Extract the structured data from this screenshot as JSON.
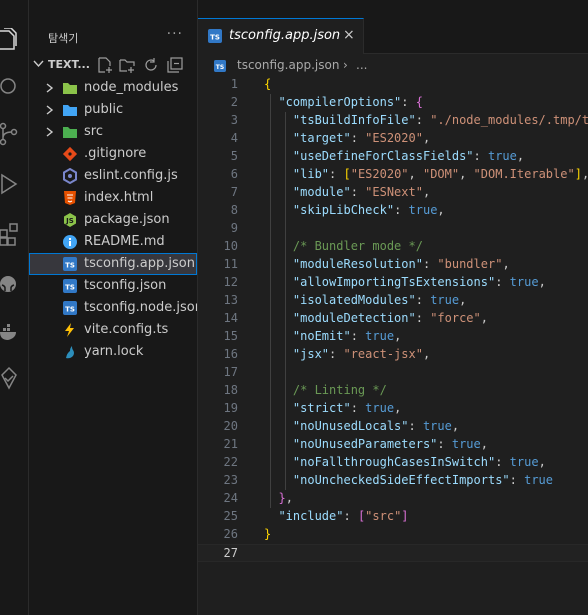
{
  "explorer": {
    "title": "탐색기",
    "more": "···",
    "folder_name": "TEXT...",
    "items": [
      {
        "label": "node_modules",
        "icon": "folder-node-icon",
        "kind": "folder",
        "color": "#8bc34a",
        "selected": false
      },
      {
        "label": "public",
        "icon": "folder-public-icon",
        "kind": "folder",
        "color": "#42a5f5",
        "selected": false
      },
      {
        "label": "src",
        "icon": "folder-src-icon",
        "kind": "folder",
        "color": "#4caf50",
        "selected": false
      },
      {
        "label": ".gitignore",
        "icon": "git-icon",
        "kind": "file",
        "color": "#e64a19",
        "selected": false
      },
      {
        "label": "eslint.config.js",
        "icon": "eslint-icon",
        "kind": "file",
        "color": "#7986cb",
        "selected": false
      },
      {
        "label": "index.html",
        "icon": "html-icon",
        "kind": "file",
        "color": "#e65100",
        "selected": false
      },
      {
        "label": "package.json",
        "icon": "nodejs-icon",
        "kind": "file",
        "color": "#8bc34a",
        "selected": false
      },
      {
        "label": "README.md",
        "icon": "info-icon",
        "kind": "file",
        "color": "#42a5f5",
        "selected": false
      },
      {
        "label": "tsconfig.app.json",
        "icon": "tsconfig-icon",
        "kind": "file",
        "color": "#3178c6",
        "selected": true
      },
      {
        "label": "tsconfig.json",
        "icon": "tsconfig-icon",
        "kind": "file",
        "color": "#3178c6",
        "selected": false
      },
      {
        "label": "tsconfig.node.json",
        "icon": "tsconfig-icon",
        "kind": "file",
        "color": "#3178c6",
        "selected": false
      },
      {
        "label": "vite.config.ts",
        "icon": "vite-icon",
        "kind": "file",
        "color": "#ffc107",
        "selected": false
      },
      {
        "label": "yarn.lock",
        "icon": "yarn-icon",
        "kind": "file",
        "color": "#2c8ebb",
        "selected": false
      }
    ]
  },
  "editor": {
    "tab_label": "tsconfig.app.json",
    "tab_close": "×",
    "breadcrumb_file": "tsconfig.app.json",
    "breadcrumb_sep": "›",
    "breadcrumb_more": "...",
    "current_line": 27,
    "lines": [
      [
        [
          "brace",
          "{"
        ]
      ],
      [
        [
          "p",
          "  "
        ],
        [
          "key",
          "\"compilerOptions\""
        ],
        [
          "p",
          ": "
        ],
        [
          "bracket",
          "{"
        ]
      ],
      [
        [
          "p",
          "    "
        ],
        [
          "key",
          "\"tsBuildInfoFile\""
        ],
        [
          "p",
          ": "
        ],
        [
          "str",
          "\"./node_modules/.tmp/t"
        ]
      ],
      [
        [
          "p",
          "    "
        ],
        [
          "key",
          "\"target\""
        ],
        [
          "p",
          ": "
        ],
        [
          "str",
          "\"ES2020\""
        ],
        [
          "p",
          ","
        ]
      ],
      [
        [
          "p",
          "    "
        ],
        [
          "key",
          "\"useDefineForClassFields\""
        ],
        [
          "p",
          ": "
        ],
        [
          "bool",
          "true"
        ],
        [
          "p",
          ","
        ]
      ],
      [
        [
          "p",
          "    "
        ],
        [
          "key",
          "\"lib\""
        ],
        [
          "p",
          ": "
        ],
        [
          "brace",
          "["
        ],
        [
          "str",
          "\"ES2020\""
        ],
        [
          "p",
          ", "
        ],
        [
          "str",
          "\"DOM\""
        ],
        [
          "p",
          ", "
        ],
        [
          "str",
          "\"DOM.Iterable\""
        ],
        [
          "brace",
          "]"
        ],
        [
          "p",
          ","
        ]
      ],
      [
        [
          "p",
          "    "
        ],
        [
          "key",
          "\"module\""
        ],
        [
          "p",
          ": "
        ],
        [
          "str",
          "\"ESNext\""
        ],
        [
          "p",
          ","
        ]
      ],
      [
        [
          "p",
          "    "
        ],
        [
          "key",
          "\"skipLibCheck\""
        ],
        [
          "p",
          ": "
        ],
        [
          "bool",
          "true"
        ],
        [
          "p",
          ","
        ]
      ],
      [],
      [
        [
          "p",
          "    "
        ],
        [
          "com",
          "/* Bundler mode */"
        ]
      ],
      [
        [
          "p",
          "    "
        ],
        [
          "key",
          "\"moduleResolution\""
        ],
        [
          "p",
          ": "
        ],
        [
          "str",
          "\"bundler\""
        ],
        [
          "p",
          ","
        ]
      ],
      [
        [
          "p",
          "    "
        ],
        [
          "key",
          "\"allowImportingTsExtensions\""
        ],
        [
          "p",
          ": "
        ],
        [
          "bool",
          "true"
        ],
        [
          "p",
          ","
        ]
      ],
      [
        [
          "p",
          "    "
        ],
        [
          "key",
          "\"isolatedModules\""
        ],
        [
          "p",
          ": "
        ],
        [
          "bool",
          "true"
        ],
        [
          "p",
          ","
        ]
      ],
      [
        [
          "p",
          "    "
        ],
        [
          "key",
          "\"moduleDetection\""
        ],
        [
          "p",
          ": "
        ],
        [
          "str",
          "\"force\""
        ],
        [
          "p",
          ","
        ]
      ],
      [
        [
          "p",
          "    "
        ],
        [
          "key",
          "\"noEmit\""
        ],
        [
          "p",
          ": "
        ],
        [
          "bool",
          "true"
        ],
        [
          "p",
          ","
        ]
      ],
      [
        [
          "p",
          "    "
        ],
        [
          "key",
          "\"jsx\""
        ],
        [
          "p",
          ": "
        ],
        [
          "str",
          "\"react-jsx\""
        ],
        [
          "p",
          ","
        ]
      ],
      [],
      [
        [
          "p",
          "    "
        ],
        [
          "com",
          "/* Linting */"
        ]
      ],
      [
        [
          "p",
          "    "
        ],
        [
          "key",
          "\"strict\""
        ],
        [
          "p",
          ": "
        ],
        [
          "bool",
          "true"
        ],
        [
          "p",
          ","
        ]
      ],
      [
        [
          "p",
          "    "
        ],
        [
          "key",
          "\"noUnusedLocals\""
        ],
        [
          "p",
          ": "
        ],
        [
          "bool",
          "true"
        ],
        [
          "p",
          ","
        ]
      ],
      [
        [
          "p",
          "    "
        ],
        [
          "key",
          "\"noUnusedParameters\""
        ],
        [
          "p",
          ": "
        ],
        [
          "bool",
          "true"
        ],
        [
          "p",
          ","
        ]
      ],
      [
        [
          "p",
          "    "
        ],
        [
          "key",
          "\"noFallthroughCasesInSwitch\""
        ],
        [
          "p",
          ": "
        ],
        [
          "bool",
          "true"
        ],
        [
          "p",
          ","
        ]
      ],
      [
        [
          "p",
          "    "
        ],
        [
          "key",
          "\"noUncheckedSideEffectImports\""
        ],
        [
          "p",
          ": "
        ],
        [
          "bool",
          "true"
        ]
      ],
      [
        [
          "p",
          "  "
        ],
        [
          "bracket",
          "}"
        ],
        [
          "p",
          ","
        ]
      ],
      [
        [
          "p",
          "  "
        ],
        [
          "key",
          "\"include\""
        ],
        [
          "p",
          ": "
        ],
        [
          "bracket",
          "["
        ],
        [
          "str",
          "\"src\""
        ],
        [
          "bracket",
          "]"
        ]
      ],
      [
        [
          "brace",
          "}"
        ]
      ],
      []
    ]
  },
  "activity_bar": [
    {
      "icon": "explorer-icon",
      "active": true
    },
    {
      "icon": "search-icon",
      "active": false
    },
    {
      "icon": "source-control-icon",
      "active": false
    },
    {
      "icon": "run-debug-icon",
      "active": false
    },
    {
      "icon": "extensions-icon",
      "active": false
    },
    {
      "icon": "github-icon",
      "active": false
    },
    {
      "icon": "docker-icon",
      "active": false
    },
    {
      "icon": "remote-explorer-icon",
      "active": false
    }
  ]
}
